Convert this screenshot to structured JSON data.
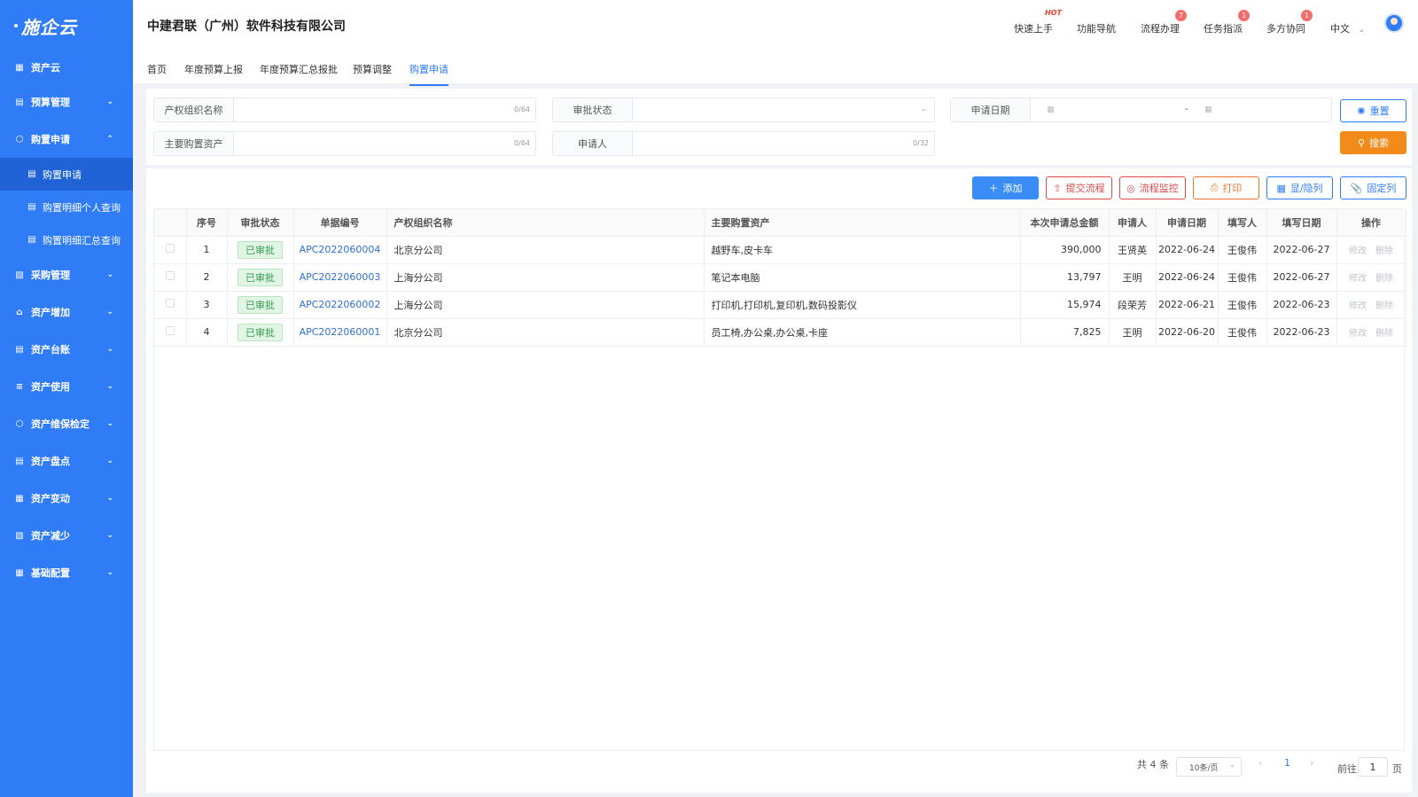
{
  "brand": {
    "logo": "施企云"
  },
  "sidebar": {
    "items": [
      {
        "label": "资产云",
        "icon": "grid-icon"
      },
      {
        "label": "预算管理",
        "icon": "coins-icon"
      },
      {
        "label": "购置申请",
        "icon": "cube-icon",
        "expanded": true
      },
      {
        "label": "采购管理",
        "icon": "clipboard-icon"
      },
      {
        "label": "资产增加",
        "icon": "house-icon"
      },
      {
        "label": "资产台账",
        "icon": "coins-icon"
      },
      {
        "label": "资产使用",
        "icon": "layers-icon"
      },
      {
        "label": "资产维保检定",
        "icon": "cube-icon"
      },
      {
        "label": "资产盘点",
        "icon": "coins-icon"
      },
      {
        "label": "资产变动",
        "icon": "grid-icon"
      },
      {
        "label": "资产减少",
        "icon": "clipboard-icon"
      },
      {
        "label": "基础配置",
        "icon": "grid-icon"
      }
    ],
    "sub_items": [
      {
        "label": "购置申请",
        "active": true
      },
      {
        "label": "购置明细个人查询"
      },
      {
        "label": "购置明细汇总查询"
      }
    ]
  },
  "header": {
    "company": "中建君联（广州）软件科技有限公司",
    "links": [
      {
        "label": "快速上手",
        "hot": "HOT"
      },
      {
        "label": "功能导航"
      },
      {
        "label": "流程办理",
        "badge": "7"
      },
      {
        "label": "任务指派",
        "badge": "1"
      },
      {
        "label": "多方协同",
        "badge": "1"
      }
    ],
    "language": "中文"
  },
  "tabs": [
    "首页",
    "年度预算上报",
    "年度预算汇总报批",
    "预算调整",
    "购置申请"
  ],
  "search": {
    "org_label": "产权组织名称",
    "org_count": "0/64",
    "status_label": "审批状态",
    "date_label": "申请日期",
    "date_sep": "-",
    "asset_label": "主要购置资产",
    "asset_count": "0/64",
    "applicant_label": "申请人",
    "applicant_count": "0/32",
    "reset": "重置",
    "search": "搜索"
  },
  "toolbar": {
    "add": "添加",
    "submit": "提交流程",
    "monitor": "流程监控",
    "print": "打印",
    "toggle_cols": "显/隐列",
    "fix_cols": "固定列"
  },
  "table": {
    "columns": [
      "序号",
      "审批状态",
      "单据编号",
      "产权组织名称",
      "主要购置资产",
      "本次申请总金额",
      "申请人",
      "申请日期",
      "填写人",
      "填写日期",
      "操作"
    ],
    "rows": [
      {
        "no": "1",
        "status": "已审批",
        "code": "APC2022060004",
        "org": "北京分公司",
        "assets": "越野车,皮卡车",
        "amount": "390,000",
        "applicant": "王贤英",
        "apply_date": "2022-06-24",
        "writer": "王俊伟",
        "write_date": "2022-06-27"
      },
      {
        "no": "2",
        "status": "已审批",
        "code": "APC2022060003",
        "org": "上海分公司",
        "assets": "笔记本电脑",
        "amount": "13,797",
        "applicant": "王明",
        "apply_date": "2022-06-24",
        "writer": "王俊伟",
        "write_date": "2022-06-27"
      },
      {
        "no": "3",
        "status": "已审批",
        "code": "APC2022060002",
        "org": "上海分公司",
        "assets": "打印机,打印机,复印机,数码投影仪",
        "amount": "15,974",
        "applicant": "段荣芳",
        "apply_date": "2022-06-21",
        "writer": "王俊伟",
        "write_date": "2022-06-23"
      },
      {
        "no": "4",
        "status": "已审批",
        "code": "APC2022060001",
        "org": "北京分公司",
        "assets": "员工椅,办公桌,办公桌,卡座",
        "amount": "7,825",
        "applicant": "王明",
        "apply_date": "2022-06-20",
        "writer": "王俊伟",
        "write_date": "2022-06-23"
      }
    ],
    "op_edit": "修改",
    "op_delete": "删除"
  },
  "pagination": {
    "total": "共 4 条",
    "page_size": "10条/页",
    "current": "1",
    "goto": "前往",
    "goto_value": "1",
    "page_unit": "页"
  }
}
